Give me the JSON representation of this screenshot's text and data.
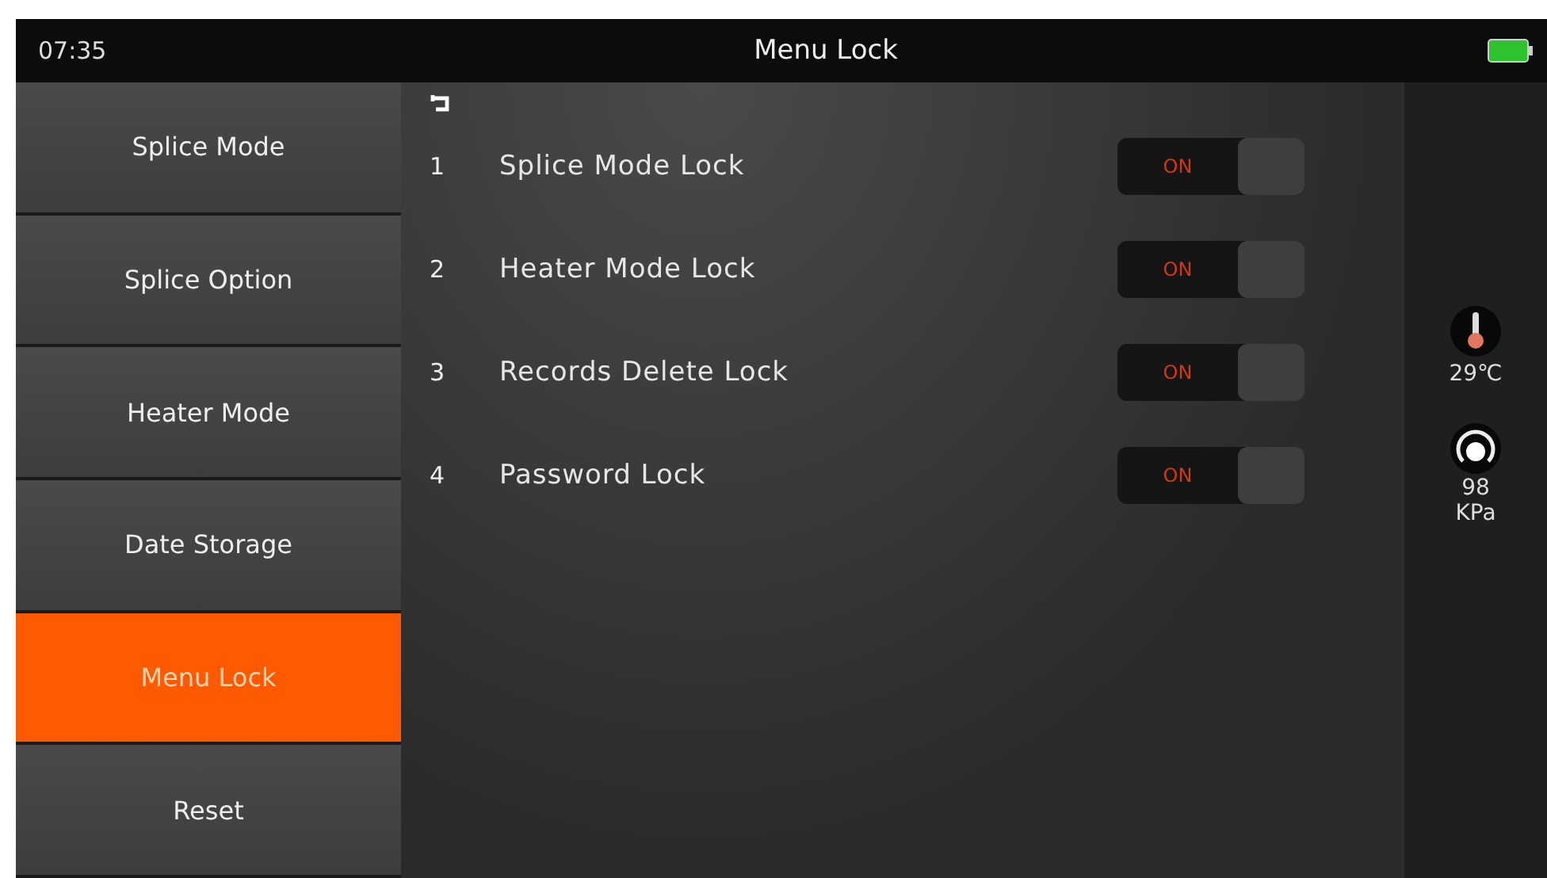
{
  "status_bar": {
    "time": "07:35",
    "title": "Menu Lock"
  },
  "sidebar": {
    "items": [
      {
        "label": "Splice Mode",
        "selected": false
      },
      {
        "label": "Splice Option",
        "selected": false
      },
      {
        "label": "Heater Mode",
        "selected": false
      },
      {
        "label": "Date Storage",
        "selected": false
      },
      {
        "label": "Menu Lock",
        "selected": true
      },
      {
        "label": "Reset",
        "selected": false
      }
    ]
  },
  "settings": [
    {
      "number": "1",
      "label": "Splice Mode Lock",
      "toggle_text": "ON",
      "on": true
    },
    {
      "number": "2",
      "label": "Heater Mode Lock",
      "toggle_text": "ON",
      "on": true
    },
    {
      "number": "3",
      "label": "Records Delete Lock",
      "toggle_text": "ON",
      "on": true
    },
    {
      "number": "4",
      "label": "Password Lock",
      "toggle_text": "ON",
      "on": true
    }
  ],
  "sensors": {
    "temperature": "29℃",
    "pressure_value": "98",
    "pressure_unit": "KPa"
  }
}
